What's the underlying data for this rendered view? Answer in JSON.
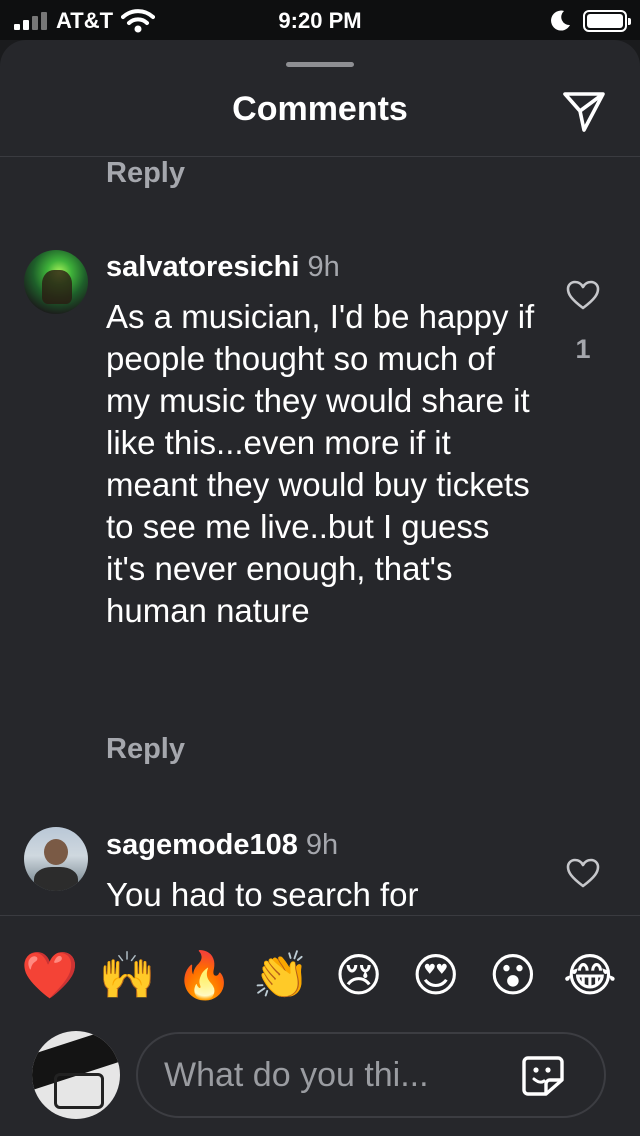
{
  "status_bar": {
    "carrier": "AT&T",
    "time": "9:20 PM"
  },
  "header": {
    "title": "Comments",
    "send_icon": "paper-plane-icon"
  },
  "comments": [
    {
      "reply_label": "Reply"
    },
    {
      "username": "salvatoresichi",
      "time_ago": "9h",
      "text": "As a musician, I'd be happy if people thought so much of my music they would share it like this...even more if it meant they would buy tickets to see me live..but I guess it's never enough, that's human nature",
      "likes": "1",
      "reply_label": "Reply"
    },
    {
      "username": "sagemode108",
      "time_ago": "9h",
      "text": "You had to search for"
    }
  ],
  "emoji_bar": [
    "❤️",
    "🙌",
    "🔥",
    "👏",
    "😢",
    "😍",
    "😮",
    "😂"
  ],
  "composer": {
    "placeholder": "What do you thi..."
  }
}
